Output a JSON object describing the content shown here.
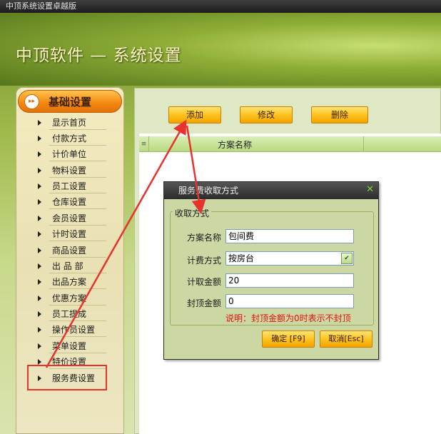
{
  "window": {
    "title": "中顶系统设置卓越版"
  },
  "header": {
    "app_title": "中顶软件 — 系统设置"
  },
  "sidebar": {
    "heading": "基础设置",
    "items": [
      {
        "label": "显示首页"
      },
      {
        "label": "付款方式"
      },
      {
        "label": "计价单位"
      },
      {
        "label": "物料设置"
      },
      {
        "label": "员工设置"
      },
      {
        "label": "仓库设置"
      },
      {
        "label": "会员设置"
      },
      {
        "label": "计时设置"
      },
      {
        "label": "商品设置"
      },
      {
        "label": "出 品 部"
      },
      {
        "label": "出品方案"
      },
      {
        "label": "优惠方案"
      },
      {
        "label": "员工提成"
      },
      {
        "label": "操作员设置"
      },
      {
        "label": "菜单设置"
      },
      {
        "label": "特价设置"
      },
      {
        "label": "服务费设置"
      }
    ]
  },
  "toolbar": {
    "add_label": "添加",
    "edit_label": "修改",
    "delete_label": "删除"
  },
  "grid": {
    "columns": [
      {
        "label": "方案名称"
      }
    ]
  },
  "dialog": {
    "title": "服务费收取方式",
    "group_label": "收取方式",
    "fields": {
      "plan_name": {
        "label": "方案名称",
        "value": "包间费"
      },
      "charge_method": {
        "label": "计费方式",
        "value": "按房台"
      },
      "charge_amount": {
        "label": "计取金额",
        "value": "20"
      },
      "cap_amount": {
        "label": "封顶金额",
        "value": "0"
      }
    },
    "note": "说明：封顶金额为0时表示不封顶",
    "ok_label": "确定 [F9]",
    "cancel_label": "取消[Esc]"
  },
  "colors": {
    "annotation": "#e8322e",
    "note_text": "#e21111",
    "button": "#ffbf1a"
  },
  "icons": {
    "dialog_close": "close-icon",
    "sidebar_heading": "double-chevron-right-icon",
    "select_chevron": "chevron-down-icon"
  }
}
